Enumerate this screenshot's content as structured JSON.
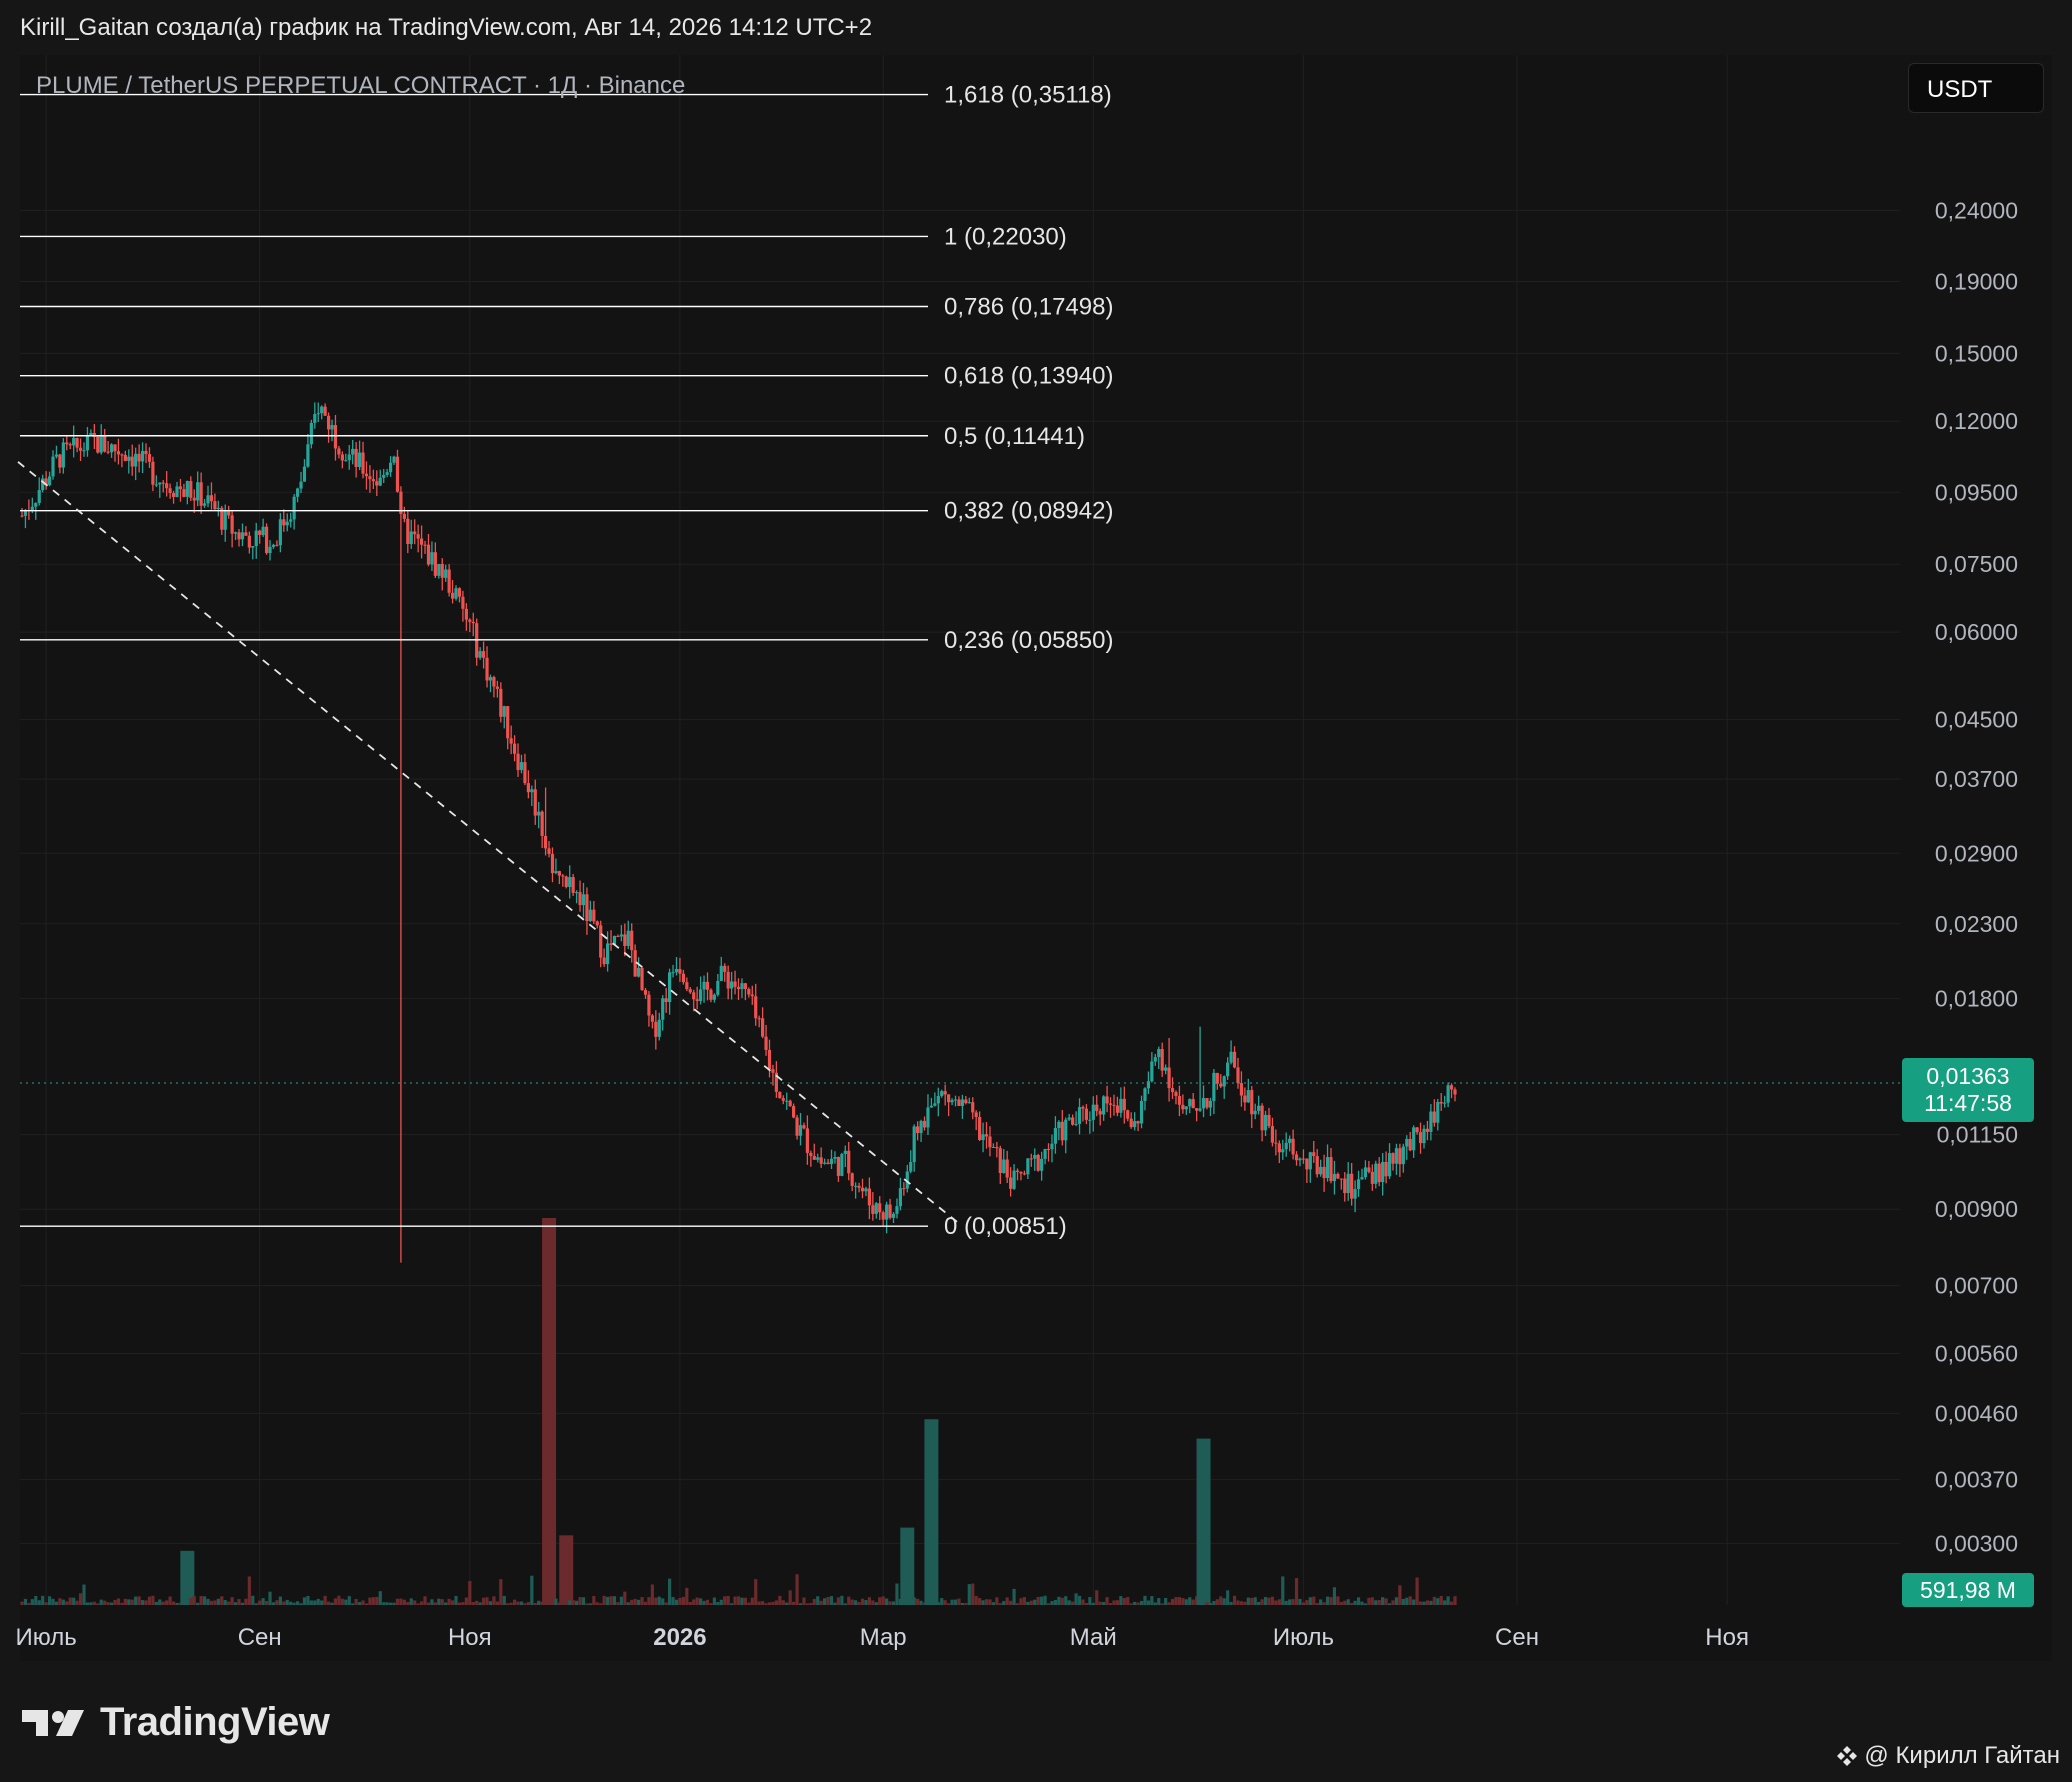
{
  "header": {
    "title": "Kirill_Gaitan создал(а) график на TradingView.com, Авг 14, 2026 14:12 UTC+2"
  },
  "chart": {
    "symbol": "PLUME / TetherUS PERPETUAL CONTRACT · 1Д · Binance",
    "currency_button": "USDT",
    "last_price": "0,01363",
    "countdown": "11:47:58",
    "volume_label": "591,98 M",
    "up_color": "#26a69a",
    "down_color": "#ef5350",
    "fib_color": "#ffffff"
  },
  "footer": {
    "brand": "TradingView",
    "author": "@ Кирилл Гайтан"
  },
  "chart_data": {
    "type": "candlestick",
    "scale": "log",
    "ylim": [
      0.00245,
      0.4
    ],
    "price_ticks": [
      "0,24000",
      "0,19000",
      "0,15000",
      "0,12000",
      "0,09500",
      "0,07500",
      "0,06000",
      "0,04500",
      "0,03700",
      "0,02900",
      "0,02300",
      "0,01800",
      "0,01150",
      "0,00900",
      "0,00700",
      "0,00560",
      "0,00460",
      "0,00370",
      "0,00300"
    ],
    "x_ticks": [
      "Июль",
      "Сен",
      "Ноя",
      "2026",
      "Мар",
      "Май",
      "Июль",
      "Сен",
      "Ноя"
    ],
    "fib_levels": [
      {
        "ratio": "1,618",
        "price": 0.35118,
        "label": "1,618 (0,35118)"
      },
      {
        "ratio": "1",
        "price": 0.2203,
        "label": "1 (0,22030)"
      },
      {
        "ratio": "0,786",
        "price": 0.17498,
        "label": "0,786 (0,17498)"
      },
      {
        "ratio": "0,618",
        "price": 0.1394,
        "label": "0,618 (0,13940)"
      },
      {
        "ratio": "0,5",
        "price": 0.11441,
        "label": "0,5 (0,11441)"
      },
      {
        "ratio": "0,382",
        "price": 0.08942,
        "label": "0,382 (0,08942)"
      },
      {
        "ratio": "0,236",
        "price": 0.0585,
        "label": "0,236 (0,05850)"
      },
      {
        "ratio": "0",
        "price": 0.00851,
        "label": "0 (0,00851)"
      }
    ],
    "trend_line": {
      "from": [
        "2025-06-24",
        0.105
      ],
      "to": [
        "2026-03-24",
        0.00851
      ],
      "style": "dashed"
    },
    "anchors": [
      [
        "2025-06-24",
        0.088
      ],
      [
        "2025-07-05",
        0.107
      ],
      [
        "2025-07-15",
        0.112
      ],
      [
        "2025-07-25",
        0.108
      ],
      [
        "2025-08-05",
        0.098
      ],
      [
        "2025-08-15",
        0.094
      ],
      [
        "2025-08-25",
        0.083
      ],
      [
        "2025-09-05",
        0.081
      ],
      [
        "2025-09-12",
        0.094
      ],
      [
        "2025-09-18",
        0.127
      ],
      [
        "2025-09-26",
        0.108
      ],
      [
        "2025-10-06",
        0.098
      ],
      [
        "2025-10-10",
        0.11
      ],
      [
        "2025-10-12",
        0.085
      ],
      [
        "2025-10-18",
        0.079
      ],
      [
        "2025-10-25",
        0.072
      ],
      [
        "2025-11-01",
        0.061
      ],
      [
        "2025-11-08",
        0.05
      ],
      [
        "2025-11-14",
        0.041
      ],
      [
        "2025-11-20",
        0.034
      ],
      [
        "2025-11-26",
        0.027
      ],
      [
        "2025-12-03",
        0.025
      ],
      [
        "2025-12-10",
        0.021
      ],
      [
        "2025-12-17",
        0.022
      ],
      [
        "2025-12-24",
        0.016
      ],
      [
        "2025-12-31",
        0.0205
      ],
      [
        "2026-01-07",
        0.018
      ],
      [
        "2026-01-14",
        0.0195
      ],
      [
        "2026-01-21",
        0.018
      ],
      [
        "2026-01-28",
        0.014
      ],
      [
        "2026-02-04",
        0.0118
      ],
      [
        "2026-02-11",
        0.0105
      ],
      [
        "2026-02-18",
        0.0105
      ],
      [
        "2026-02-25",
        0.0092
      ],
      [
        "2026-03-04",
        0.0088
      ],
      [
        "2026-03-11",
        0.0118
      ],
      [
        "2026-03-18",
        0.0131
      ],
      [
        "2026-03-25",
        0.0125
      ],
      [
        "2026-04-01",
        0.011
      ],
      [
        "2026-04-08",
        0.0098
      ],
      [
        "2026-04-15",
        0.0106
      ],
      [
        "2026-04-22",
        0.0117
      ],
      [
        "2026-04-29",
        0.0123
      ],
      [
        "2026-05-06",
        0.0131
      ],
      [
        "2026-05-13",
        0.0118
      ],
      [
        "2026-05-20",
        0.0153
      ],
      [
        "2026-05-27",
        0.0122
      ],
      [
        "2026-06-03",
        0.0131
      ],
      [
        "2026-06-10",
        0.0145
      ],
      [
        "2026-06-17",
        0.0126
      ],
      [
        "2026-06-24",
        0.0113
      ],
      [
        "2026-07-01",
        0.0104
      ],
      [
        "2026-07-08",
        0.0104
      ],
      [
        "2026-07-15",
        0.0096
      ],
      [
        "2026-07-22",
        0.0101
      ],
      [
        "2026-07-29",
        0.0106
      ],
      [
        "2026-08-05",
        0.0118
      ],
      [
        "2026-08-14",
        0.01363
      ]
    ],
    "spikes": [
      {
        "date": "2025-10-12",
        "low": 0.00755
      },
      {
        "date": "2025-11-23",
        "high": 0.036
      },
      {
        "date": "2026-05-23",
        "high": 0.0158
      },
      {
        "date": "2026-06-01",
        "high": 0.0164
      }
    ],
    "volume_spikes": [
      {
        "date": "2025-11-24",
        "value": 1.0
      },
      {
        "date": "2026-03-15",
        "value": 0.48
      },
      {
        "date": "2026-06-02",
        "value": 0.43
      },
      {
        "date": "2026-03-08",
        "value": 0.2
      },
      {
        "date": "2025-11-29",
        "value": 0.18
      },
      {
        "date": "2025-08-11",
        "value": 0.14
      }
    ]
  }
}
